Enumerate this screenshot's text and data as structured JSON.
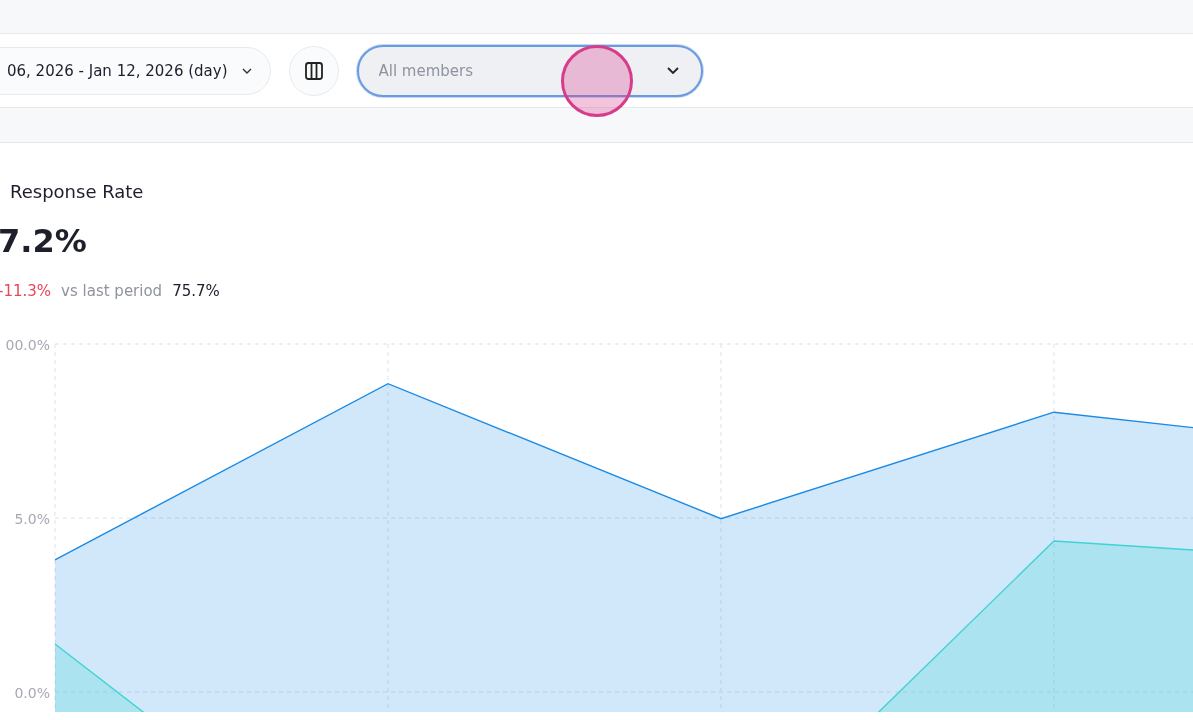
{
  "toolbar": {
    "date_range": "06, 2026 - Jan 12, 2026 (day)",
    "members_select": {
      "placeholder": "All members",
      "focused": true
    }
  },
  "metric": {
    "title": "Response Rate",
    "value": "7.2%",
    "change": "-11.3%",
    "comparison_label": "vs last period",
    "previous_value": "75.7%"
  },
  "chart": {
    "kind": "area",
    "y_axis_labels": [
      "00.0%",
      "5.0%",
      "0.0%"
    ]
  }
}
